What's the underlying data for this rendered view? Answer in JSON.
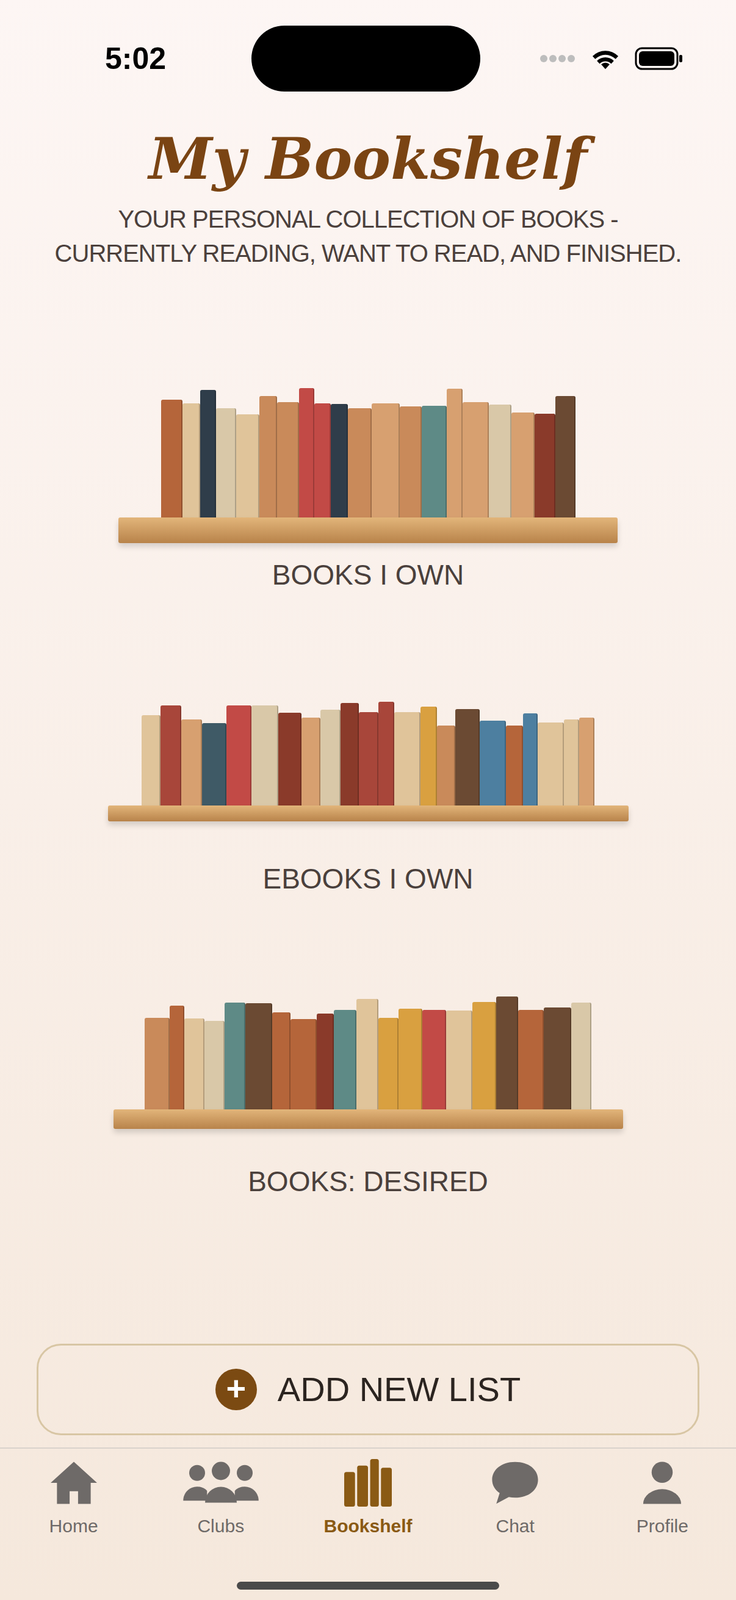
{
  "status_bar": {
    "time": "5:02"
  },
  "header": {
    "title": "My Bookshelf",
    "subtitle": "YOUR PERSONAL COLLECTION OF BOOKS - CURRENTLY READING, WANT TO READ, AND FINISHED."
  },
  "shelves": [
    {
      "label": "BOOKS I OWN"
    },
    {
      "label": "EBOOKS I OWN"
    },
    {
      "label": "BOOKS: DESIRED"
    }
  ],
  "add_button": {
    "icon": "+",
    "label": "ADD NEW LIST"
  },
  "tab_bar": [
    {
      "label": "Home",
      "selected": false
    },
    {
      "label": "Clubs",
      "selected": false
    },
    {
      "label": "Bookshelf",
      "selected": true
    },
    {
      "label": "Chat",
      "selected": false
    },
    {
      "label": "Profile",
      "selected": false
    }
  ]
}
